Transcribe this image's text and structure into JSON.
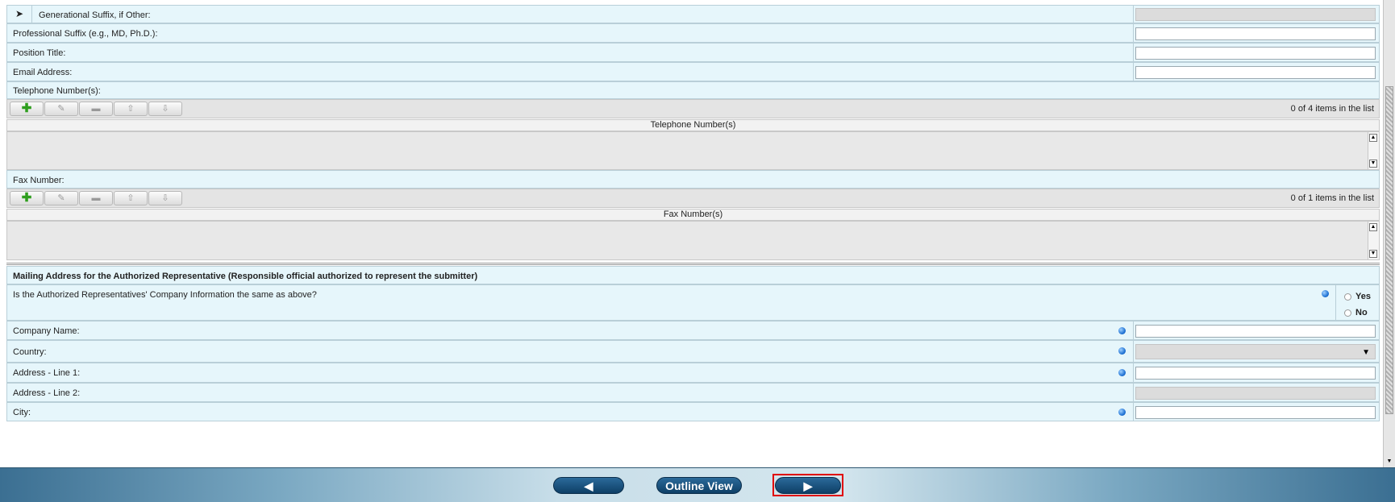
{
  "fields": {
    "generational_suffix": "Generational Suffix, if Other:",
    "professional_suffix": "Professional Suffix (e.g., MD, Ph.D.):",
    "position_title": "Position Title:",
    "email_address": "Email Address:"
  },
  "telephone": {
    "label": "Telephone Number(s):",
    "count": "0 of 4 items in the list",
    "column": "Telephone Number(s)"
  },
  "fax": {
    "label": "Fax Number:",
    "count": "0 of 1 items in the list",
    "column": "Fax Number(s)"
  },
  "mailing": {
    "heading": "Mailing Address for the Authorized Representative (Responsible official authorized to represent the submitter)",
    "same_question": "Is the Authorized Representatives' Company Information the same as above?",
    "yes_label": "Yes",
    "no_label": "No",
    "company_name": "Company Name:",
    "country": "Country:",
    "address1": "Address - Line 1:",
    "address2": "Address - Line 2:",
    "city": "City:"
  },
  "toolbar_icons": [
    "add-icon",
    "edit-icon",
    "remove-icon",
    "move-up-icon",
    "move-down-icon"
  ],
  "footer": {
    "back_glyph": "◀",
    "outline_label": "Outline View",
    "next_glyph": "▶"
  },
  "colors": {
    "row_bg": "#e6f6fb",
    "required_dot": "#1b6fd2",
    "highlight_outline": "#e00000",
    "nav_button": "#0e3f66"
  }
}
